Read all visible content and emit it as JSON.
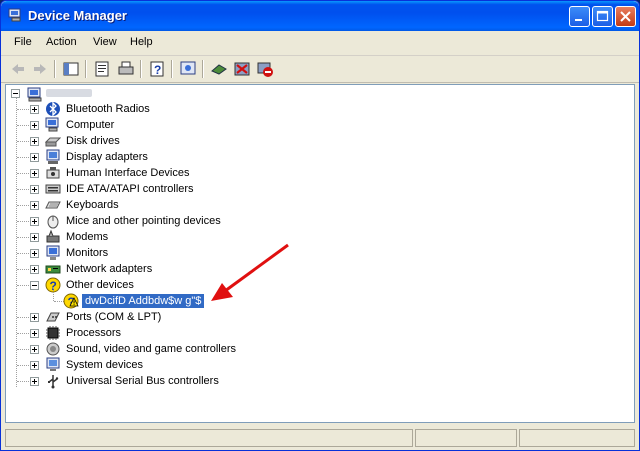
{
  "window": {
    "title": "Device Manager"
  },
  "menu": [
    "File",
    "Action",
    "View",
    "Help"
  ],
  "toolbar": {
    "buttons": [
      "back",
      "forward",
      "show-hide-console-tree",
      "properties",
      "print",
      "help",
      "scan-hardware",
      "update-driver",
      "uninstall",
      "disable"
    ]
  },
  "tree": {
    "root_label": "",
    "items": [
      {
        "label": "Bluetooth Radios",
        "icon": "bluetooth-icon",
        "expanded": false
      },
      {
        "label": "Computer",
        "icon": "computer-icon",
        "expanded": false
      },
      {
        "label": "Disk drives",
        "icon": "disk-drive-icon",
        "expanded": false
      },
      {
        "label": "Display adapters",
        "icon": "display-adapter-icon",
        "expanded": false
      },
      {
        "label": "Human Interface Devices",
        "icon": "hid-icon",
        "expanded": false
      },
      {
        "label": "IDE ATA/ATAPI controllers",
        "icon": "ide-controller-icon",
        "expanded": false
      },
      {
        "label": "Keyboards",
        "icon": "keyboard-icon",
        "expanded": false
      },
      {
        "label": "Mice and other pointing devices",
        "icon": "mouse-icon",
        "expanded": false
      },
      {
        "label": "Modems",
        "icon": "modem-icon",
        "expanded": false
      },
      {
        "label": "Monitors",
        "icon": "monitor-icon",
        "expanded": false
      },
      {
        "label": "Network adapters",
        "icon": "network-adapter-icon",
        "expanded": false
      },
      {
        "label": "Other devices",
        "icon": "unknown-device-icon",
        "expanded": true
      },
      {
        "label": "dwDcifD Addbdw$w  g\"$",
        "icon": "unknown-device-warning-icon",
        "child": true,
        "selected": true
      },
      {
        "label": "Ports (COM & LPT)",
        "icon": "port-icon",
        "expanded": false
      },
      {
        "label": "Processors",
        "icon": "processor-icon",
        "expanded": false
      },
      {
        "label": "Sound, video and game controllers",
        "icon": "sound-icon",
        "expanded": false
      },
      {
        "label": "System devices",
        "icon": "system-device-icon",
        "expanded": false
      },
      {
        "label": "Universal Serial Bus controllers",
        "icon": "usb-icon",
        "expanded": false
      }
    ]
  },
  "colors": {
    "titlebar": "#0054e3",
    "selection": "#316ac5",
    "annotation_arrow": "#e01010"
  }
}
